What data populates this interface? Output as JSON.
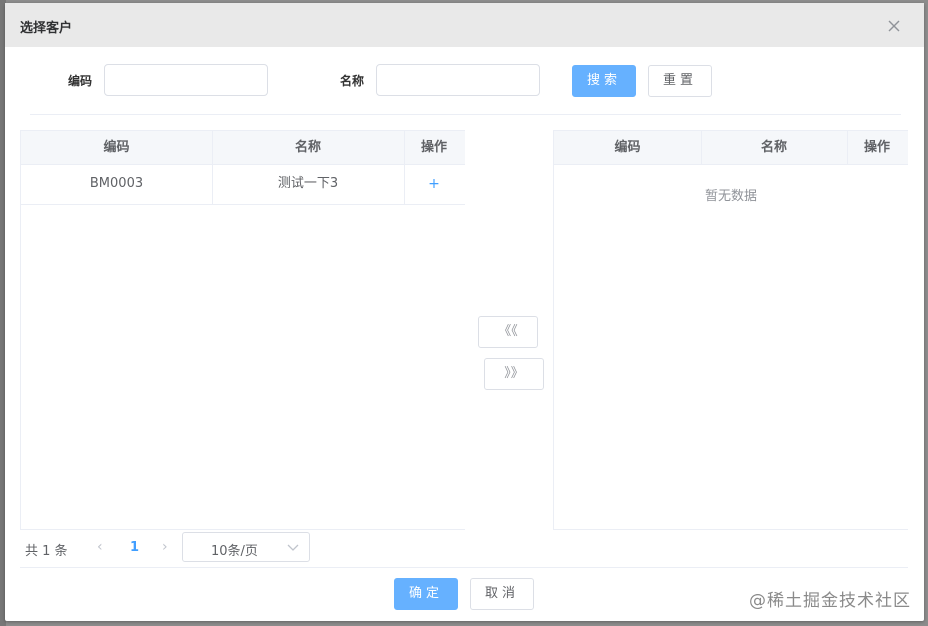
{
  "dialog": {
    "title": "选择客户"
  },
  "search": {
    "code_label": "编码",
    "code_value": "",
    "name_label": "名称",
    "name_value": "",
    "search_button": "搜索",
    "reset_button": "重置"
  },
  "left_table": {
    "columns": [
      "编码",
      "名称",
      "操作"
    ],
    "rows": [
      {
        "code": "BM0003",
        "name": "测试一下3",
        "action": "+"
      }
    ]
  },
  "transfer": {
    "move_left": "《《",
    "move_right": "》》"
  },
  "right_table": {
    "columns": [
      "编码",
      "名称",
      "操作"
    ],
    "empty_text": "暂无数据"
  },
  "pagination": {
    "total": "共 1 条",
    "current_page": "1",
    "page_size": "10条/页"
  },
  "footer": {
    "confirm_button": "确定",
    "cancel_button": "取消"
  },
  "watermark": "@稀土掘金技术社区",
  "colors": {
    "primary": "#66b1ff",
    "link": "#409eff",
    "header_bg": "#e9e9e9"
  }
}
